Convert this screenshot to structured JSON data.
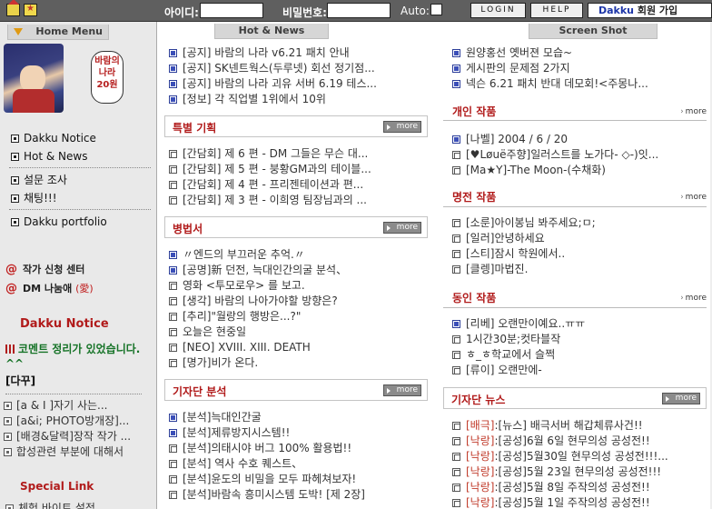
{
  "topbar": {
    "id_label": "아이디:",
    "pw_label": "비밀번호:",
    "auto_label": "Auto:",
    "login_label": "LOGIN",
    "help_label": "HELP",
    "join_brand": "Dakku",
    "join_label": "회원 가입"
  },
  "left": {
    "home_menu": "Home Menu",
    "bubble": "바람의 나라 20원",
    "menu1": [
      "Dakku Notice",
      "Hot & News"
    ],
    "menu2": [
      "설문 조사",
      "채팅!!!"
    ],
    "menu3": [
      "Dakku portfolio"
    ],
    "apply_label": "작가 신청 센터",
    "dm_label": "DM 나눔애",
    "dm_paren": "(愛)",
    "notice_head": "Dakku Notice",
    "notice_line": "코멘트 정리가 있었습니다. ^^",
    "dakku_tag": "[다꾸]",
    "small_items": [
      "[a & I ]자기 사는...",
      "[a&i; PHOTO방개장]...",
      "[배경&달력]장작 작가 ...",
      "합성관련 부분에 대해서"
    ],
    "special_head": "Special Link",
    "special_item": "체험 바이트 설정"
  },
  "mid": {
    "head": "Hot & News",
    "news": [
      "[공지] 바람의 나라 v6.21 패치 안내",
      "[공지] SK넨트웍스(두루넷) 회선 정기점...",
      "[공지] 바람의 나라 괴유 서버 6.19 테스...",
      "[정보] 각 직업별 1위에서 10위"
    ],
    "special_title": "특별 기획",
    "special": [
      "[간담회] 제 6 편 - DM 그들은 무슨 대...",
      "[간담회] 제 5 편 - 붕황GM과의 테이블...",
      "[간담회] 제 4 편 - 프리젠테이션과 편...",
      "[간담회] 제 3 편 - 이희영 팀장님과의 ..."
    ],
    "byeong_title": "병법서",
    "byeong": [
      "〃엔드의 부끄러운 추억.〃",
      "[공명]新 던전, 늑대인간의굴 분석、",
      "영화 <투모로우> 를 보고.",
      "[생각] 바람의 나아가야할 방향은?",
      "[추리]\"월랑의 행방은...?\"",
      "오늘은 현중일",
      "[NEO] XVIII. XIII. DEATH",
      "[명가]비가 온다."
    ],
    "analysis_title": "기자단 분석",
    "analysis": [
      "[분석]늑대인간굴",
      "[분석]제류방지시스템!!",
      "[분석]의태시야 버그 100% 활용법!!",
      "[분석] 역사 수호 퀘스트、",
      "[분석]윤도의 비밀을 모두 파헤쳐보자!",
      "[분석]바람속 흥미시스템 도박! [제 2장]"
    ]
  },
  "right": {
    "head": "Screen Shot",
    "shots": [
      "원양홍선 옛버젼 모습~",
      "게시판의 문제점 2가지",
      "넥슨 6.21 패치 반대 데모회!<주몽나..."
    ],
    "personal_title": "개인 작품",
    "personal": [
      "[나벨] 2004 / 6 / 20",
      "[♥Løuё주향]일러스트를 노가다- ◇-)잇...",
      "[Ma★Y]-The Moon-(수채화)"
    ],
    "famous_title": "명전 작품",
    "famous": [
      "[소룬]아이봉님 봐주세요;ㅁ;",
      "[일러]안녕하세요",
      "[스티]잠시 학원에서..",
      "[클렝]마법진."
    ],
    "club_title": "동인 작품",
    "club": [
      "[리베] 오랜만이예요..ㅠㅠ",
      "1시간30분;컷타블작",
      "ㅎ_ㅎ학교에서 슬쩍",
      "[류이] 오랜만에-"
    ],
    "reporter_title": "기자단 뉴스",
    "reporter": [
      {
        "tag": "[배극]",
        "text": ":[뉴스] 배극서버 해갑체류사건!!"
      },
      {
        "tag": "[낙랑]",
        "text": ":[공성]6월 6일 현무의성 공성전!!"
      },
      {
        "tag": "[낙랑]",
        "text": ":[공성]5월30일 현무의성 공성전!!!..."
      },
      {
        "tag": "[낙랑]",
        "text": ":[공성]5월 23일 현무의성 공성전!!!"
      },
      {
        "tag": "[낙랑]",
        "text": ":[공성]5월 8일 주작의성 공성전!!"
      },
      {
        "tag": "[낙랑]",
        "text": ":[공성]5월 1일 주작의성 공성전!!"
      }
    ],
    "more_label": "more"
  }
}
